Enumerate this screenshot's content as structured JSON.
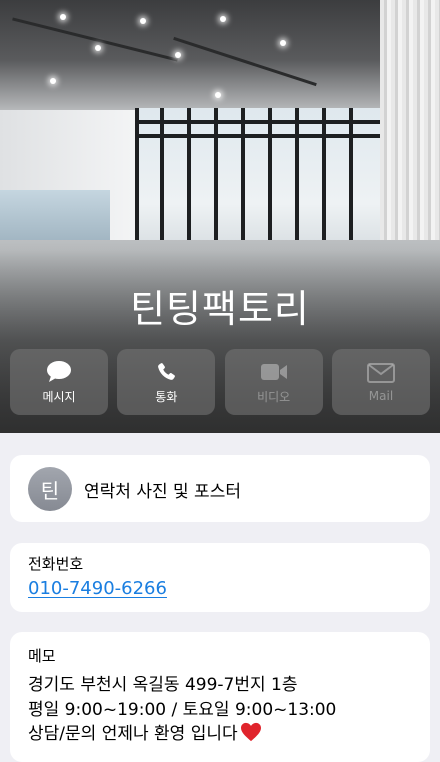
{
  "contact": {
    "name": "틴팅팩토리",
    "avatar_initial": "틴"
  },
  "actions": [
    {
      "label": "메시지",
      "icon": "message-icon",
      "enabled": true
    },
    {
      "label": "통화",
      "icon": "phone-icon",
      "enabled": true
    },
    {
      "label": "비디오",
      "icon": "video-icon",
      "enabled": false
    },
    {
      "label": "Mail",
      "icon": "mail-icon",
      "enabled": false
    }
  ],
  "photo_card": {
    "label": "연락처 사진 및 포스터"
  },
  "phone_card": {
    "label": "전화번호",
    "number": "010-7490-6266"
  },
  "memo_card": {
    "label": "메모",
    "lines": [
      "경기도 부천시 옥길동 499-7번지 1층",
      "평일 9:00~19:00 / 토요일 9:00~13:00",
      "상담/문의 언제나 환영 입니다"
    ],
    "trailing_emoji": "heart-icon"
  },
  "colors": {
    "link": "#1a7ee0",
    "background": "#efeff4",
    "heart": "#e0242c"
  }
}
